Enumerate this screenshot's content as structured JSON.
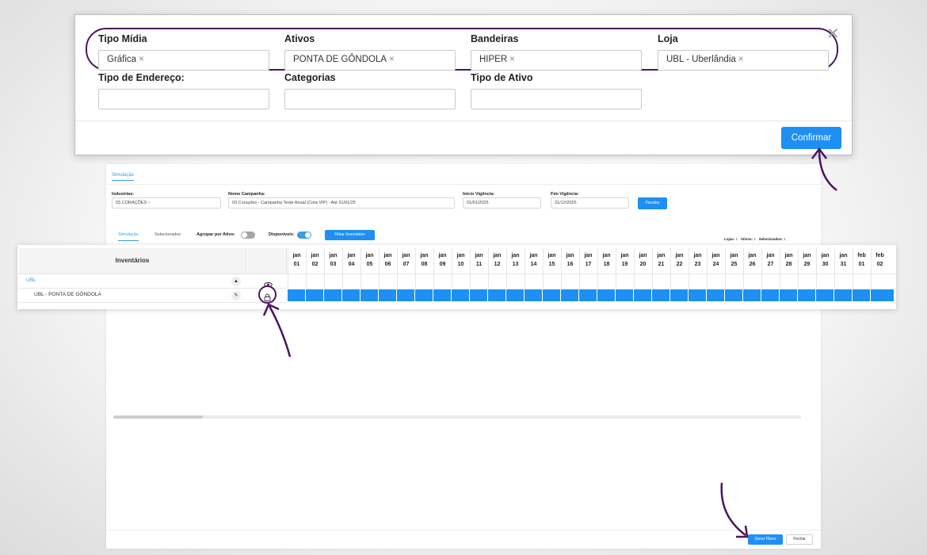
{
  "filter_modal": {
    "fields": [
      {
        "label": "Tipo Mídia",
        "tags": [
          "Gráfica"
        ]
      },
      {
        "label": "Ativos",
        "tags": [
          "PONTA DE GÔNDOLA"
        ]
      },
      {
        "label": "Bandeiras",
        "tags": [
          "HIPER"
        ]
      },
      {
        "label": "Loja",
        "tags": [
          "UBL - Uberlândia"
        ]
      },
      {
        "label": "Tipo de Endereço:",
        "tags": []
      },
      {
        "label": "Categorias",
        "tags": []
      },
      {
        "label": "Tipo de Ativo",
        "tags": []
      }
    ],
    "confirm_label": "Confirmar",
    "close_icon": "close-icon"
  },
  "main": {
    "top_tab": "Simulação",
    "industrias": {
      "label": "Industrias:",
      "tag": "03 CORAÇÕES"
    },
    "campanha": {
      "label": "Nome Campanha:",
      "value": "03 Corações - Campanha Teste Anual (Cota VIP) - Até 31/01/25"
    },
    "inicio": {
      "label": "Início Vigência:",
      "value": "01/01/2025"
    },
    "fim": {
      "label": "Fim Vigência:",
      "value": "31/12/2025"
    },
    "pacotes_label": "Pacotes",
    "tabs": [
      "Simulação",
      "Selecionados"
    ],
    "agrupar_label": "Agrupar por Ativo:",
    "disponiveis_label": "Disponíveis:",
    "filtrar_label": "Filtrar Inventários",
    "counts": {
      "lojas_label": "Lojas:",
      "lojas": "1",
      "ativos_label": "Ativos:",
      "ativos": "1",
      "selecionados_label": "Selecionados:",
      "selecionados": "1"
    },
    "gerar_label": "Gerar Plano",
    "fechar_label": "Fechar"
  },
  "table": {
    "header": "Inventários",
    "rows": [
      {
        "label": "UBL",
        "control": "▲",
        "icon": "eye-icon"
      },
      {
        "label": "UBL - PONTA DE GÔNDOLA",
        "control": "✎",
        "icon": "lock-icon"
      }
    ],
    "dates": [
      {
        "m": "jan",
        "d": "01"
      },
      {
        "m": "jan",
        "d": "02"
      },
      {
        "m": "jan",
        "d": "03"
      },
      {
        "m": "jan",
        "d": "04"
      },
      {
        "m": "jan",
        "d": "05"
      },
      {
        "m": "jan",
        "d": "06"
      },
      {
        "m": "jan",
        "d": "07"
      },
      {
        "m": "jan",
        "d": "08"
      },
      {
        "m": "jan",
        "d": "09"
      },
      {
        "m": "jan",
        "d": "10"
      },
      {
        "m": "jan",
        "d": "11"
      },
      {
        "m": "jan",
        "d": "12"
      },
      {
        "m": "jan",
        "d": "13"
      },
      {
        "m": "jan",
        "d": "14"
      },
      {
        "m": "jan",
        "d": "15"
      },
      {
        "m": "jan",
        "d": "16"
      },
      {
        "m": "jan",
        "d": "17"
      },
      {
        "m": "jan",
        "d": "18"
      },
      {
        "m": "jan",
        "d": "19"
      },
      {
        "m": "jan",
        "d": "20"
      },
      {
        "m": "jan",
        "d": "21"
      },
      {
        "m": "jan",
        "d": "22"
      },
      {
        "m": "jan",
        "d": "23"
      },
      {
        "m": "jan",
        "d": "24"
      },
      {
        "m": "jan",
        "d": "25"
      },
      {
        "m": "jan",
        "d": "26"
      },
      {
        "m": "jan",
        "d": "27"
      },
      {
        "m": "jan",
        "d": "28"
      },
      {
        "m": "jan",
        "d": "29"
      },
      {
        "m": "jan",
        "d": "30"
      },
      {
        "m": "jan",
        "d": "31"
      },
      {
        "m": "feb",
        "d": "01"
      },
      {
        "m": "feb",
        "d": "02"
      }
    ]
  },
  "colors": {
    "accent": "#1e8ff3",
    "highlight": "#4b1560"
  }
}
